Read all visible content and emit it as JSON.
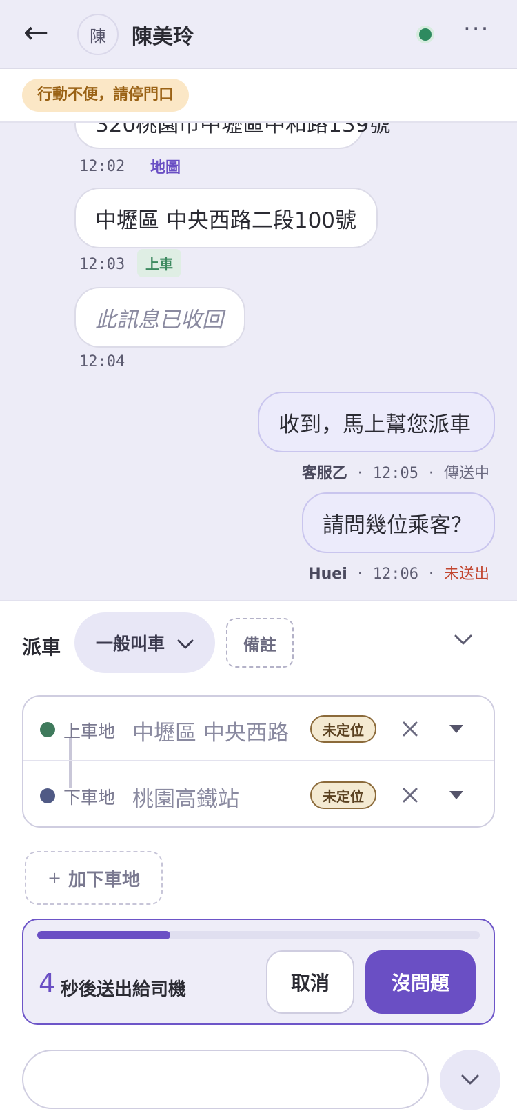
{
  "header": {
    "back_icon": "←",
    "avatar_initial": "陳",
    "contact_name": "陳美玲",
    "more_icon": "···",
    "online_color": "#2e8a5f"
  },
  "notice": {
    "text": "行動不便，請停門口"
  },
  "messages": {
    "m1": {
      "text": "320桃園市中壢區中和路139號",
      "time": "12:02",
      "tag": "地圖"
    },
    "m2": {
      "text": "中壢區 中央西路二段100號",
      "time": "12:03",
      "tag": "上車"
    },
    "m3": {
      "text": "此訊息已收回",
      "time": "12:04"
    },
    "m4": {
      "text": "收到，馬上幫您派車",
      "sender": "客服乙",
      "time": "12:05",
      "status": "傳送中"
    },
    "m5": {
      "text": "請問幾位乘客？",
      "sender": "Huei",
      "time": "12:06",
      "status": "未送出"
    },
    "separator": "·"
  },
  "dispatch": {
    "label": "派車",
    "type_value": "一般叫車",
    "note_label": "備註",
    "pickup": {
      "label": "上車地",
      "value": "中壢區 中央西路",
      "badge": "未定位",
      "dot_color": "#3f7a5c"
    },
    "dropoff": {
      "label": "下車地",
      "value": "桃園高鐵站",
      "badge": "未定位",
      "dot_color": "#505a85"
    },
    "add_dest_plus": "+",
    "add_dest_label": "加下車地"
  },
  "countdown": {
    "seconds": "4",
    "text": "秒後送出給司機",
    "progress": 0.3,
    "cancel_label": "取消",
    "ok_label": "沒問題",
    "accent": "#6a4fc4"
  },
  "composer": {
    "value": "",
    "placeholder": ""
  }
}
